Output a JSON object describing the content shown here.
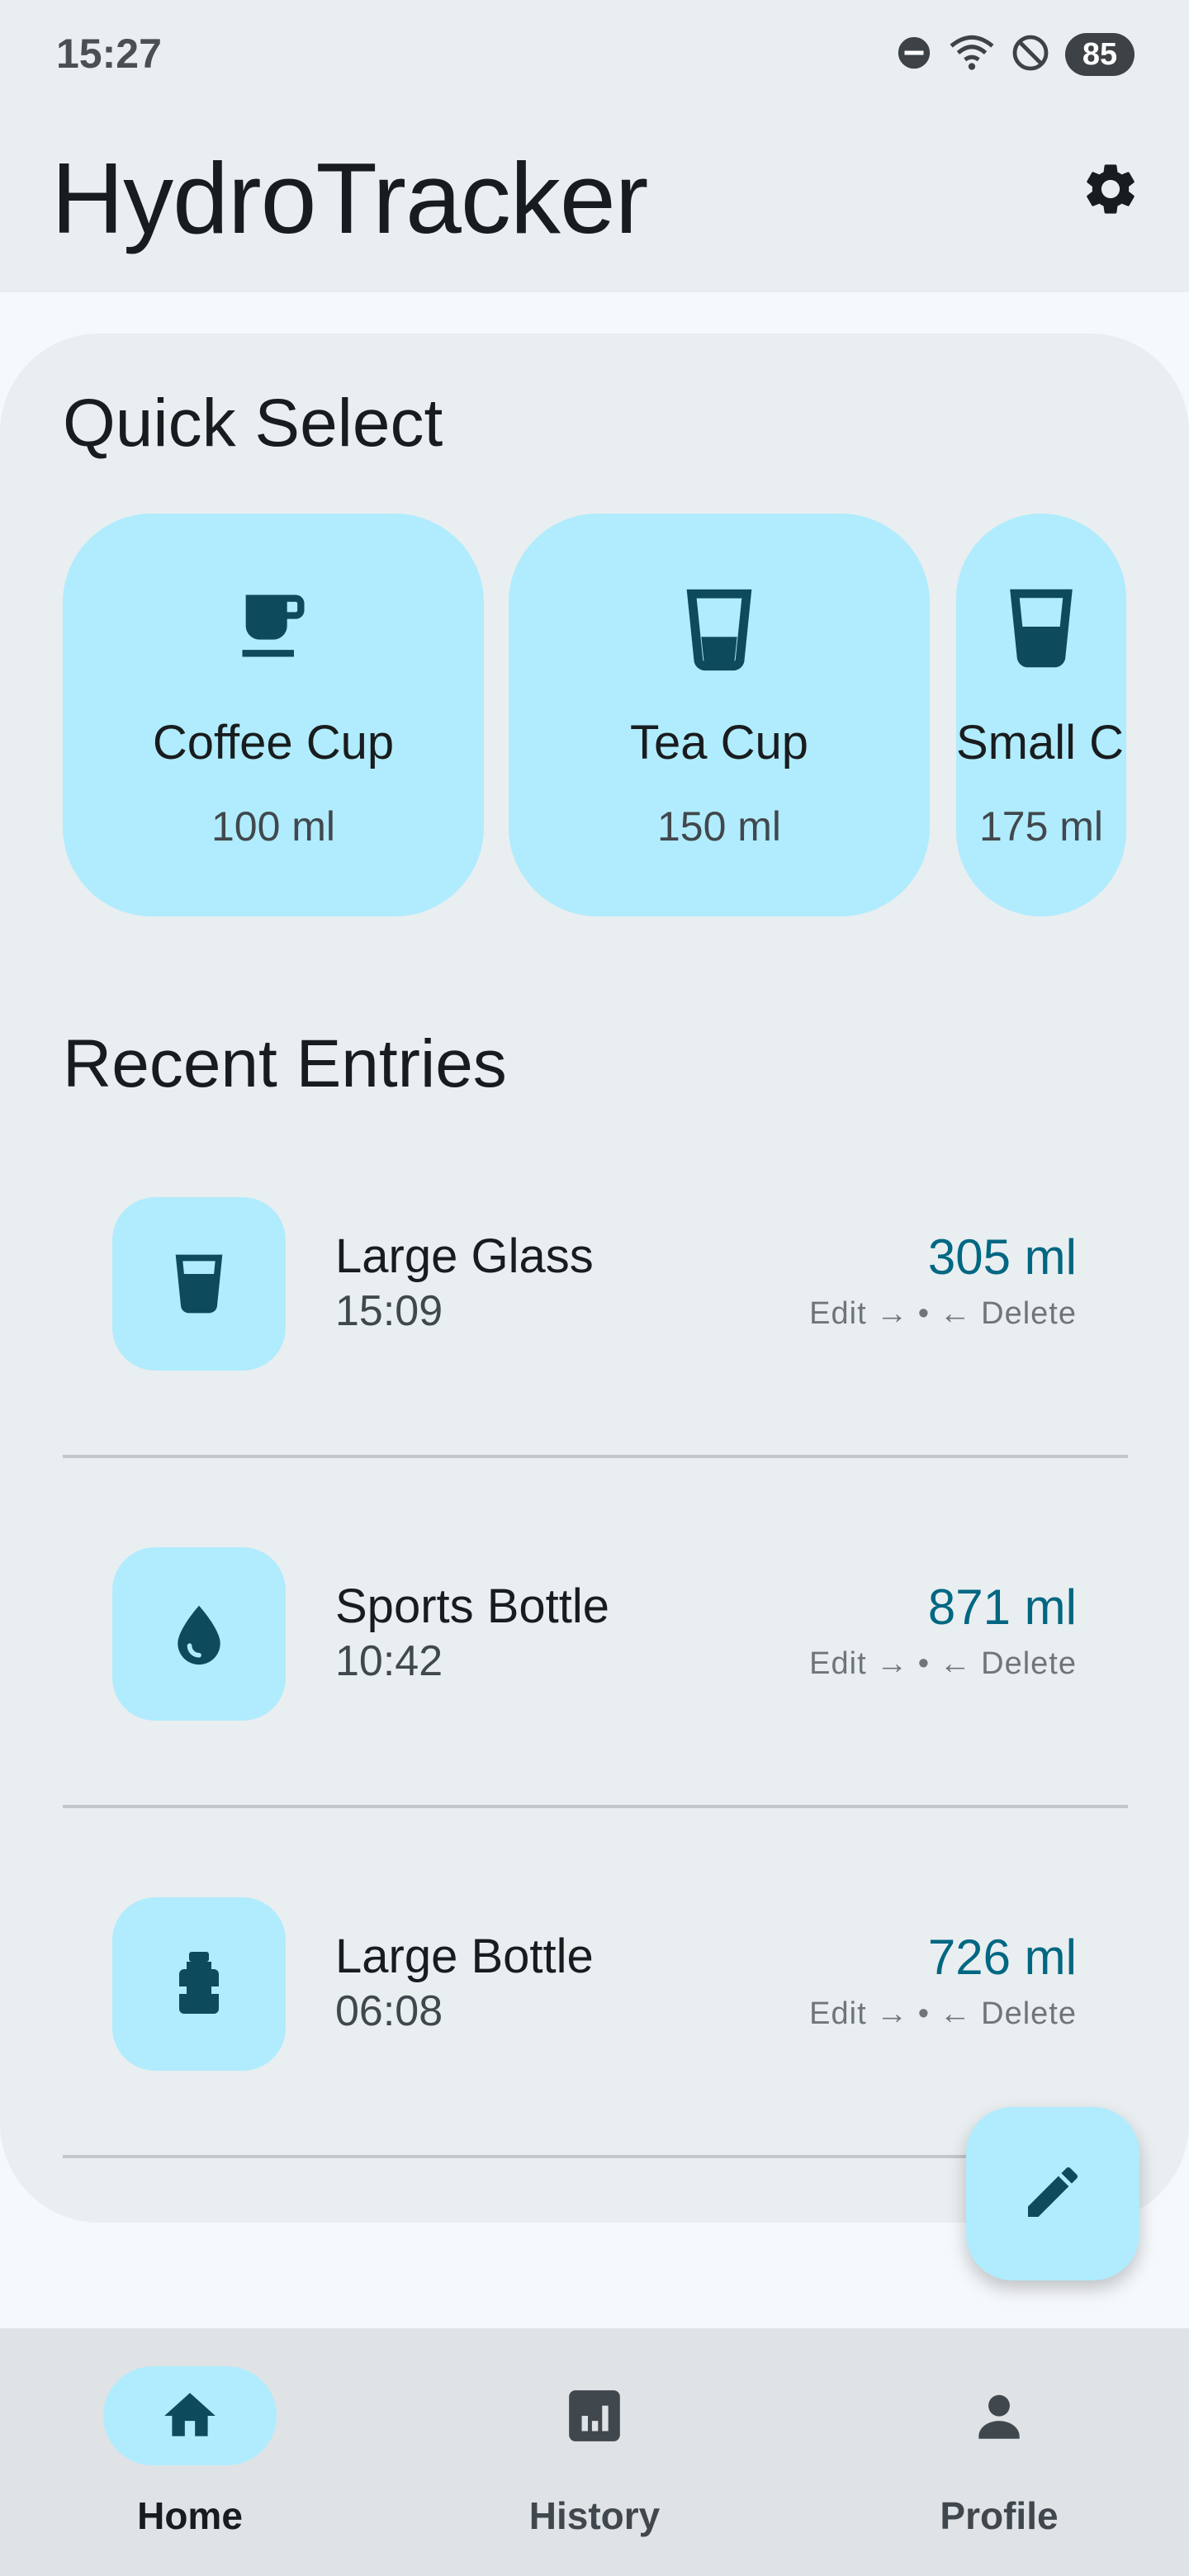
{
  "status_bar": {
    "time": "15:27",
    "battery": "85",
    "icons": [
      "do-not-disturb-icon",
      "wifi-icon",
      "blocked-icon",
      "battery-icon"
    ]
  },
  "app_bar": {
    "title": "HydroTracker",
    "settings_icon": "gear-icon"
  },
  "quick_select": {
    "title": "Quick Select",
    "items": [
      {
        "name": "Coffee Cup",
        "volume": "100 ml",
        "icon": "coffee-cup-icon"
      },
      {
        "name": "Tea Cup",
        "volume": "150 ml",
        "icon": "glass-icon"
      },
      {
        "name": "Small Cup",
        "volume": "175 ml",
        "icon": "glass-half-icon"
      }
    ]
  },
  "recent": {
    "title": "Recent Entries",
    "entries": [
      {
        "name": "Large Glass",
        "time": "15:09",
        "volume": "305 ml",
        "actions": "Edit → • ← Delete",
        "icon": "glass-full-icon"
      },
      {
        "name": "Sports Bottle",
        "time": "10:42",
        "volume": "871 ml",
        "actions": "Edit → • ← Delete",
        "icon": "water-drop-icon"
      },
      {
        "name": "Large Bottle",
        "time": "06:08",
        "volume": "726 ml",
        "actions": "Edit → • ← Delete",
        "icon": "bottle-icon"
      }
    ]
  },
  "fab": {
    "icon": "pencil-icon"
  },
  "nav": {
    "items": [
      {
        "label": "Home",
        "icon": "home-icon",
        "active": true
      },
      {
        "label": "History",
        "icon": "bar-chart-icon",
        "active": false
      },
      {
        "label": "Profile",
        "icon": "person-icon",
        "active": false
      }
    ]
  },
  "colors": {
    "accent_container": "#b0ecfd",
    "accent_text": "#006782",
    "icon_dark": "#0d4a5c",
    "surface": "#e9eef1",
    "background": "#f5f9fc"
  }
}
